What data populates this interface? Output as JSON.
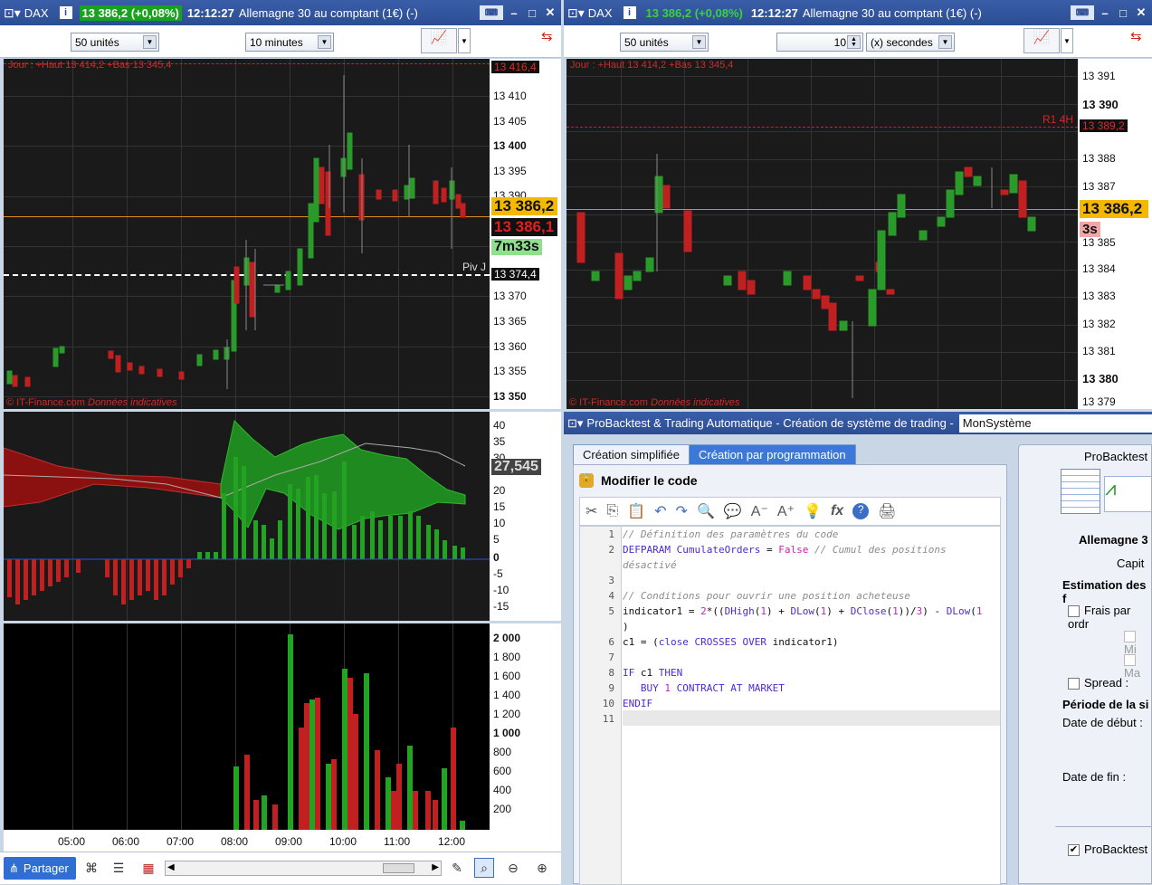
{
  "left": {
    "instrument": "DAX",
    "price": "13 386,2 (+0,08%)",
    "time": "12:12:27",
    "title": "Allemagne 30 au comptant (1€) (-)",
    "units": "50 unités",
    "timeframe": "10 minutes",
    "day_label": "Jour : +Haut 13 414,2 +Bas 13 345,4",
    "day_high_tag": "13 416,4",
    "price_tag": "13 386,2",
    "price_tag2": "13 386,1",
    "countdown": "7m33s",
    "piv_label": "Piv J",
    "piv_tag": "13 374,4",
    "watermark": "© IT-Finance.com",
    "watermark2": "Données indicatives",
    "y_ticks": [
      "13 410",
      "13 405",
      "13 400",
      "13 395",
      "13 390",
      "13 385",
      "13 380",
      "13 375",
      "13 370",
      "13 365",
      "13 360",
      "13 355",
      "13 350"
    ],
    "osc_ticks": [
      "40",
      "35",
      "30",
      "25",
      "20",
      "15",
      "10",
      "5",
      "0",
      "-5",
      "-10",
      "-15"
    ],
    "osc_tag": "27,545",
    "vol_ticks": [
      "2 000",
      "1 800",
      "1 600",
      "1 400",
      "1 200",
      "1 000",
      "800",
      "600",
      "400",
      "200"
    ],
    "x_ticks": [
      "05:00",
      "06:00",
      "07:00",
      "08:00",
      "09:00",
      "10:00",
      "11:00",
      "12:00"
    ],
    "share_label": "Partager"
  },
  "right": {
    "instrument": "DAX",
    "price": "13 386,2 (+0,08%)",
    "time": "12:12:27",
    "title": "Allemagne 30 au comptant (1€) (-)",
    "units": "50 unités",
    "period_value": "10",
    "period_unit": "(x) secondes",
    "day_label": "Jour : +Haut 13 414,2 +Bas 13 345,4",
    "r1_label": "R1 4H",
    "r1_tag": "13 389,2",
    "price_tag": "13 386,2",
    "countdown": "3s",
    "watermark": "© IT-Finance.com",
    "watermark2": "Données indicatives",
    "y_ticks": [
      "13 391",
      "13 390",
      "13 389",
      "13 388",
      "13 387",
      "13 386",
      "13 385",
      "13 384",
      "13 383",
      "13 382",
      "13 381",
      "13 380",
      "13 379"
    ]
  },
  "backtest": {
    "window_title": "ProBacktest & Trading Automatique - Création de système de trading -",
    "system_name": "MonSystème",
    "tab_simple": "Création simplifiée",
    "tab_program": "Création par programmation",
    "edit_label": "Modifier le code",
    "code_lines": [
      "// Définition des paramètres du code",
      "DEFPARAM CumulateOrders = False // Cumul des positions",
      "désactivé",
      "",
      "// Conditions pour ouvrir une position acheteuse",
      "indicator1 = 2*((DHigh(1) + DLow(1) + DClose(1))/3) - DLow(1",
      ")",
      "c1 = (close CROSSES OVER indicator1)",
      "",
      "IF c1 THEN",
      "   BUY 1 CONTRACT AT MARKET",
      "ENDIF",
      ""
    ],
    "line_numbers": [
      "1",
      "2",
      "",
      "3",
      "4",
      "5",
      "",
      "6",
      "7",
      "8",
      "9",
      "10",
      "11"
    ],
    "side_title": "ProBacktest",
    "side_instrument": "Allemagne 3",
    "side_capital": "Capit",
    "side_fees": "Estimation des f",
    "side_fees_order": "Frais par ordr",
    "side_min": "Mi",
    "side_max": "Ma",
    "side_spread": "Spread :",
    "side_period": "Période de la si",
    "side_start": "Date de début :",
    "side_end": "Date de fin :",
    "side_check": "ProBacktest"
  }
}
